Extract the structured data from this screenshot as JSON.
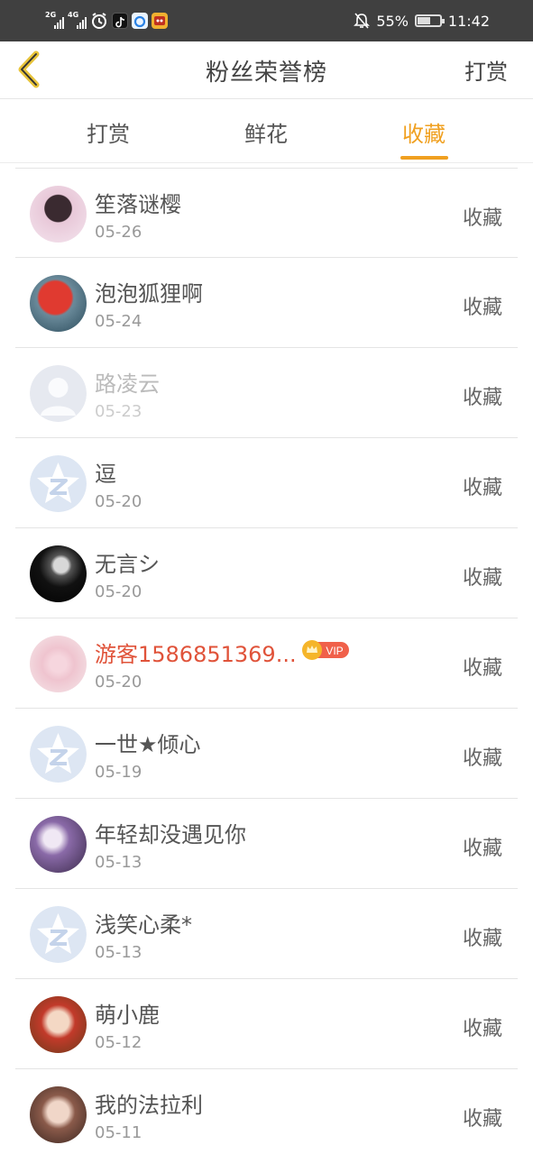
{
  "status_bar": {
    "signal1": "2G",
    "signal2": "4G",
    "battery_percent": "55%",
    "time": "11:42",
    "icons": [
      "alarm-icon",
      "tiktok-icon",
      "app-icon",
      "game-icon",
      "mute-icon",
      "battery-icon"
    ]
  },
  "header": {
    "title": "粉丝荣誉榜",
    "action": "打赏"
  },
  "tabs": [
    {
      "label": "打赏",
      "active": false
    },
    {
      "label": "鲜花",
      "active": false
    },
    {
      "label": "收藏",
      "active": true
    }
  ],
  "colors": {
    "accent": "#f0a020",
    "vip_name": "#e0533a",
    "status_bar": "#404040"
  },
  "rows": [
    {
      "name": "笙落谜樱",
      "date": "05-26",
      "action": "收藏",
      "avatar": "photo"
    },
    {
      "name": "泡泡狐狸啊",
      "date": "05-24",
      "action": "收藏",
      "avatar": "photo"
    },
    {
      "name": "路凌云",
      "date": "05-23",
      "action": "收藏",
      "avatar": "default-person"
    },
    {
      "name": "逗",
      "date": "05-20",
      "action": "收藏",
      "avatar": "default-z"
    },
    {
      "name": "无言シ",
      "date": "05-20",
      "action": "收藏",
      "avatar": "photo"
    },
    {
      "name": "游客1586851369...",
      "date": "05-20",
      "action": "收藏",
      "avatar": "photo",
      "vip_badge": "VIP"
    },
    {
      "name": "一世★倾心",
      "date": "05-19",
      "action": "收藏",
      "avatar": "default-z"
    },
    {
      "name": "年轻却没遇见你",
      "date": "05-13",
      "action": "收藏",
      "avatar": "photo"
    },
    {
      "name": "浅笑心柔*",
      "date": "05-13",
      "action": "收藏",
      "avatar": "default-z"
    },
    {
      "name": "萌小鹿",
      "date": "05-12",
      "action": "收藏",
      "avatar": "photo"
    },
    {
      "name": "我的法拉利",
      "date": "05-11",
      "action": "收藏",
      "avatar": "photo"
    }
  ]
}
